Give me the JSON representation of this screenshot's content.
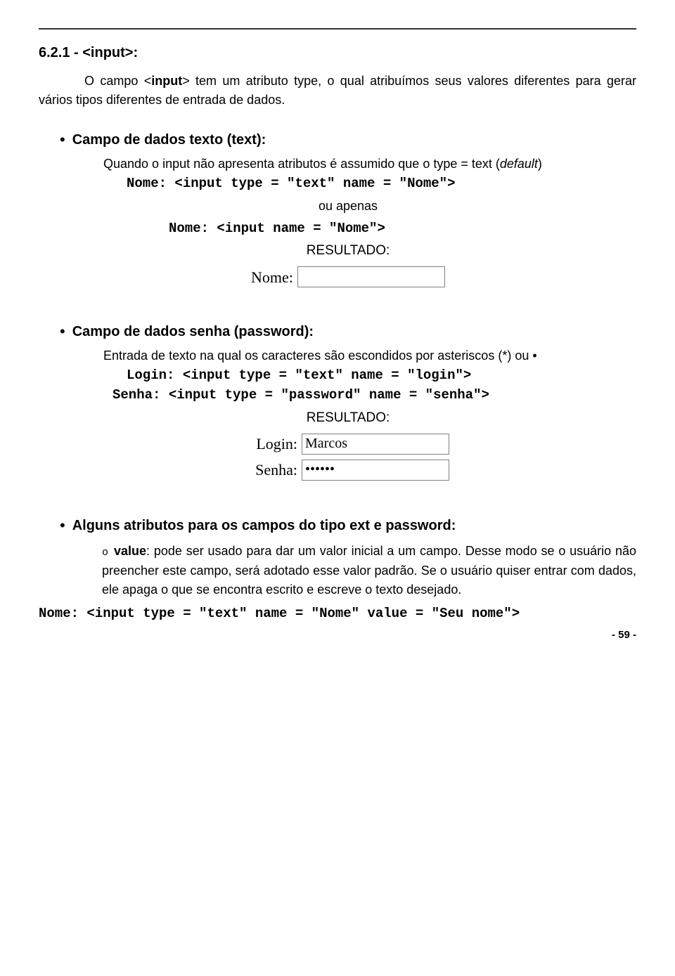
{
  "section_heading": "6.2.1 - <input>:",
  "intro_pre": "O campo <",
  "intro_bold": "input",
  "intro_post": "> tem um atributo type, o qual atribuímos seus valores diferentes para gerar vários tipos diferentes de entrada de dados.",
  "b1": {
    "title": "Campo de dados texto (text):",
    "body_pre": "Quando o input não apresenta atributos é assumido que o type = text (",
    "body_italic": "default",
    "body_post": ")",
    "code1": "Nome: <input type = \"text\" name = \"Nome\">",
    "mid": "ou apenas",
    "code2": "Nome: <input name = \"Nome\">",
    "result": "RESULTADO:",
    "ex_label": "Nome:",
    "ex_value": ""
  },
  "b2": {
    "title": "Campo de dados senha (password):",
    "body": "Entrada de texto na qual os caracteres são escondidos por asteriscos (*) ou •",
    "code1": "Login: <input type = \"text\" name = \"login\">",
    "code2": "Senha: <input type = \"password\" name = \"senha\">",
    "result": "RESULTADO:",
    "ex_login_label": "Login:",
    "ex_login_value": "Marcos",
    "ex_senha_label": "Senha:",
    "ex_senha_value": "••••••"
  },
  "b3": {
    "title": "Alguns atributos para os campos do tipo ext e password:",
    "sub_marker": "o",
    "sub_attr": "value",
    "sub_text": ": pode ser usado para dar um valor inicial a um campo. Desse modo se o usuário não preencher este campo, será adotado esse valor padrão. Se o usuário quiser entrar com dados, ele apaga o que se encontra escrito e escreve o texto desejado."
  },
  "footer_code": "Nome: <input type = \"text\" name = \"Nome\" value = \"Seu nome\">",
  "page_num": "- 59 -"
}
